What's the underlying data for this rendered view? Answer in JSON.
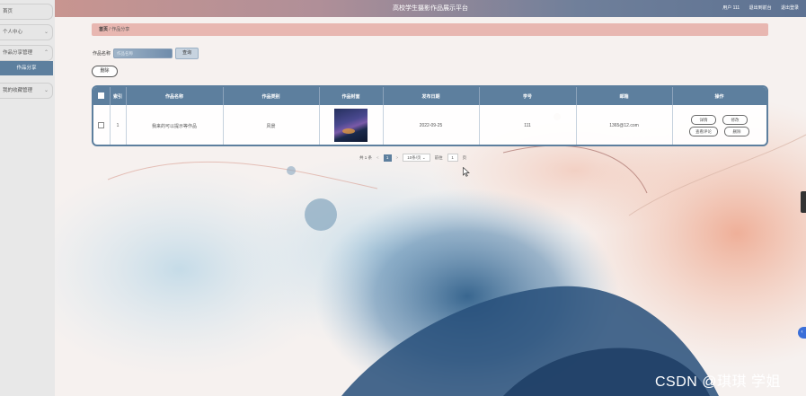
{
  "app": {
    "title": "高校学生摄影作品展示平台",
    "user_label": "用户 111",
    "back_home": "退出到前台",
    "logout": "退出登录"
  },
  "sidebar": {
    "items": [
      {
        "label": "首页"
      },
      {
        "label": "个人中心"
      },
      {
        "label": "作品分享管理"
      },
      {
        "label": "作品分享",
        "active": true
      },
      {
        "label": "我的收藏管理"
      }
    ]
  },
  "breadcrumb": {
    "home": "首页",
    "sep": "/",
    "current": "作品分享"
  },
  "search": {
    "label": "作品名称",
    "placeholder": "作品名称",
    "button": "查询"
  },
  "toolbar": {
    "delete_label": "删除"
  },
  "table": {
    "headers": [
      "",
      "索引",
      "作品名称",
      "作品类别",
      "作品封面",
      "发布日期",
      "学号",
      "邮箱",
      "操作"
    ],
    "rows": [
      {
        "index": "1",
        "name": "我来的可以提示等作品",
        "category": "风景",
        "date": "2022-09-25",
        "student_id": "111",
        "email": "1365@12.com",
        "actions": [
          "详情",
          "修改",
          "查看评论",
          "删除"
        ]
      }
    ]
  },
  "pagination": {
    "total": "共 1 条",
    "prev": "<",
    "page": "1",
    "next": ">",
    "page_size": "10条/页",
    "goto_label": "前往",
    "goto_value": "1",
    "page_suffix": "页"
  },
  "watermark": "CSDN @琪琪 学姐",
  "colors": {
    "primary": "#5d7f9e",
    "breadcrumb_bg": "#e8b7b1"
  }
}
